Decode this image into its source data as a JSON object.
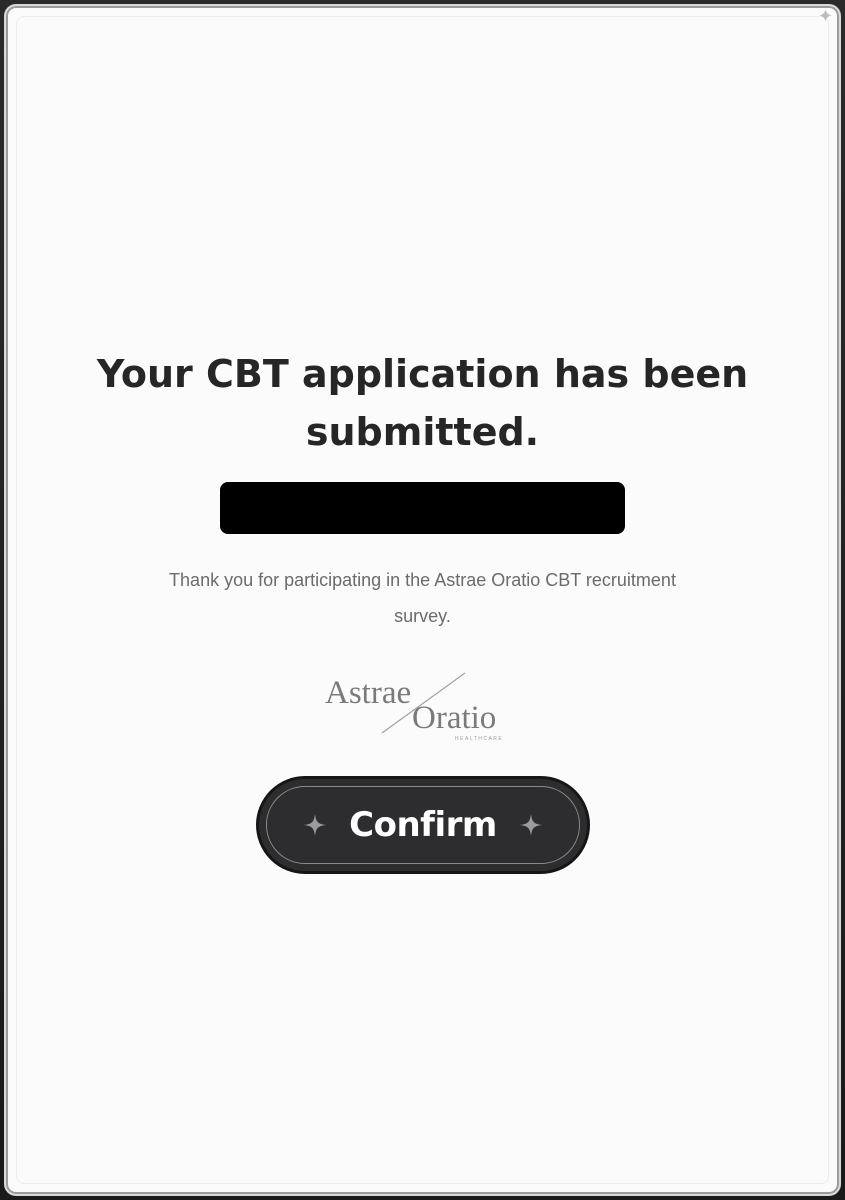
{
  "dialog": {
    "title": "Your CBT application has been submitted.",
    "message": "Thank you for participating in the Astrae Oratio CBT recruitment survey.",
    "logo": {
      "word1": "Astrae",
      "word2": "Oratio",
      "tagline": "HEALTHCARE"
    },
    "confirm_label": "Confirm",
    "corner_icon": "sparkle-icon",
    "button_icons": [
      "sparkle-icon",
      "sparkle-icon"
    ],
    "colors": {
      "button_bg": "#2d2d2f",
      "title": "#262626",
      "message": "#6b6b6b"
    }
  }
}
